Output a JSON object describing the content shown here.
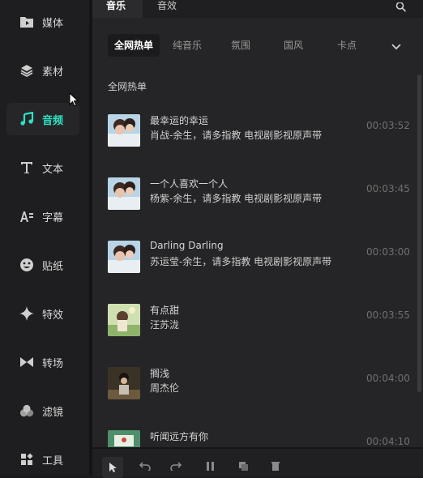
{
  "sidebar": {
    "items": [
      {
        "label": "媒体",
        "icon": "media-icon"
      },
      {
        "label": "素材",
        "icon": "layers-icon"
      },
      {
        "label": "音频",
        "icon": "music-note-icon"
      },
      {
        "label": "文本",
        "icon": "text-icon"
      },
      {
        "label": "字幕",
        "icon": "subtitle-icon"
      },
      {
        "label": "贴纸",
        "icon": "sticker-icon"
      },
      {
        "label": "特效",
        "icon": "sparkle-icon"
      },
      {
        "label": "转场",
        "icon": "transition-icon"
      },
      {
        "label": "滤镜",
        "icon": "filter-icon"
      },
      {
        "label": "工具",
        "icon": "tools-icon"
      }
    ],
    "active_index": 2
  },
  "tabs": [
    {
      "label": "音乐"
    },
    {
      "label": "音效"
    }
  ],
  "chips": [
    "全网热单",
    "纯音乐",
    "氛围",
    "国风",
    "卡点"
  ],
  "section_title": "全网热单",
  "tracks": [
    {
      "title": "最幸运的幸运",
      "artist": "肖战-余生，请多指教 电视剧影视原声带",
      "duration": "00:03:52"
    },
    {
      "title": "一个人喜欢一个人",
      "artist": "杨紫-余生，请多指教 电视剧影视原声带",
      "duration": "00:03:45"
    },
    {
      "title": "Darling Darling",
      "artist": "苏运莹-余生，请多指教 电视剧影视原声带",
      "duration": "00:03:00"
    },
    {
      "title": "有点甜",
      "artist": "汪苏泷",
      "duration": "00:03:55"
    },
    {
      "title": "搁浅",
      "artist": "周杰伦",
      "duration": "00:04:00"
    },
    {
      "title": "听闻远方有你",
      "artist": "",
      "duration": "00:04:10"
    }
  ],
  "colors": {
    "accent": "#2fe0c3",
    "background": "#252527",
    "sidebar": "#1e1e20"
  }
}
